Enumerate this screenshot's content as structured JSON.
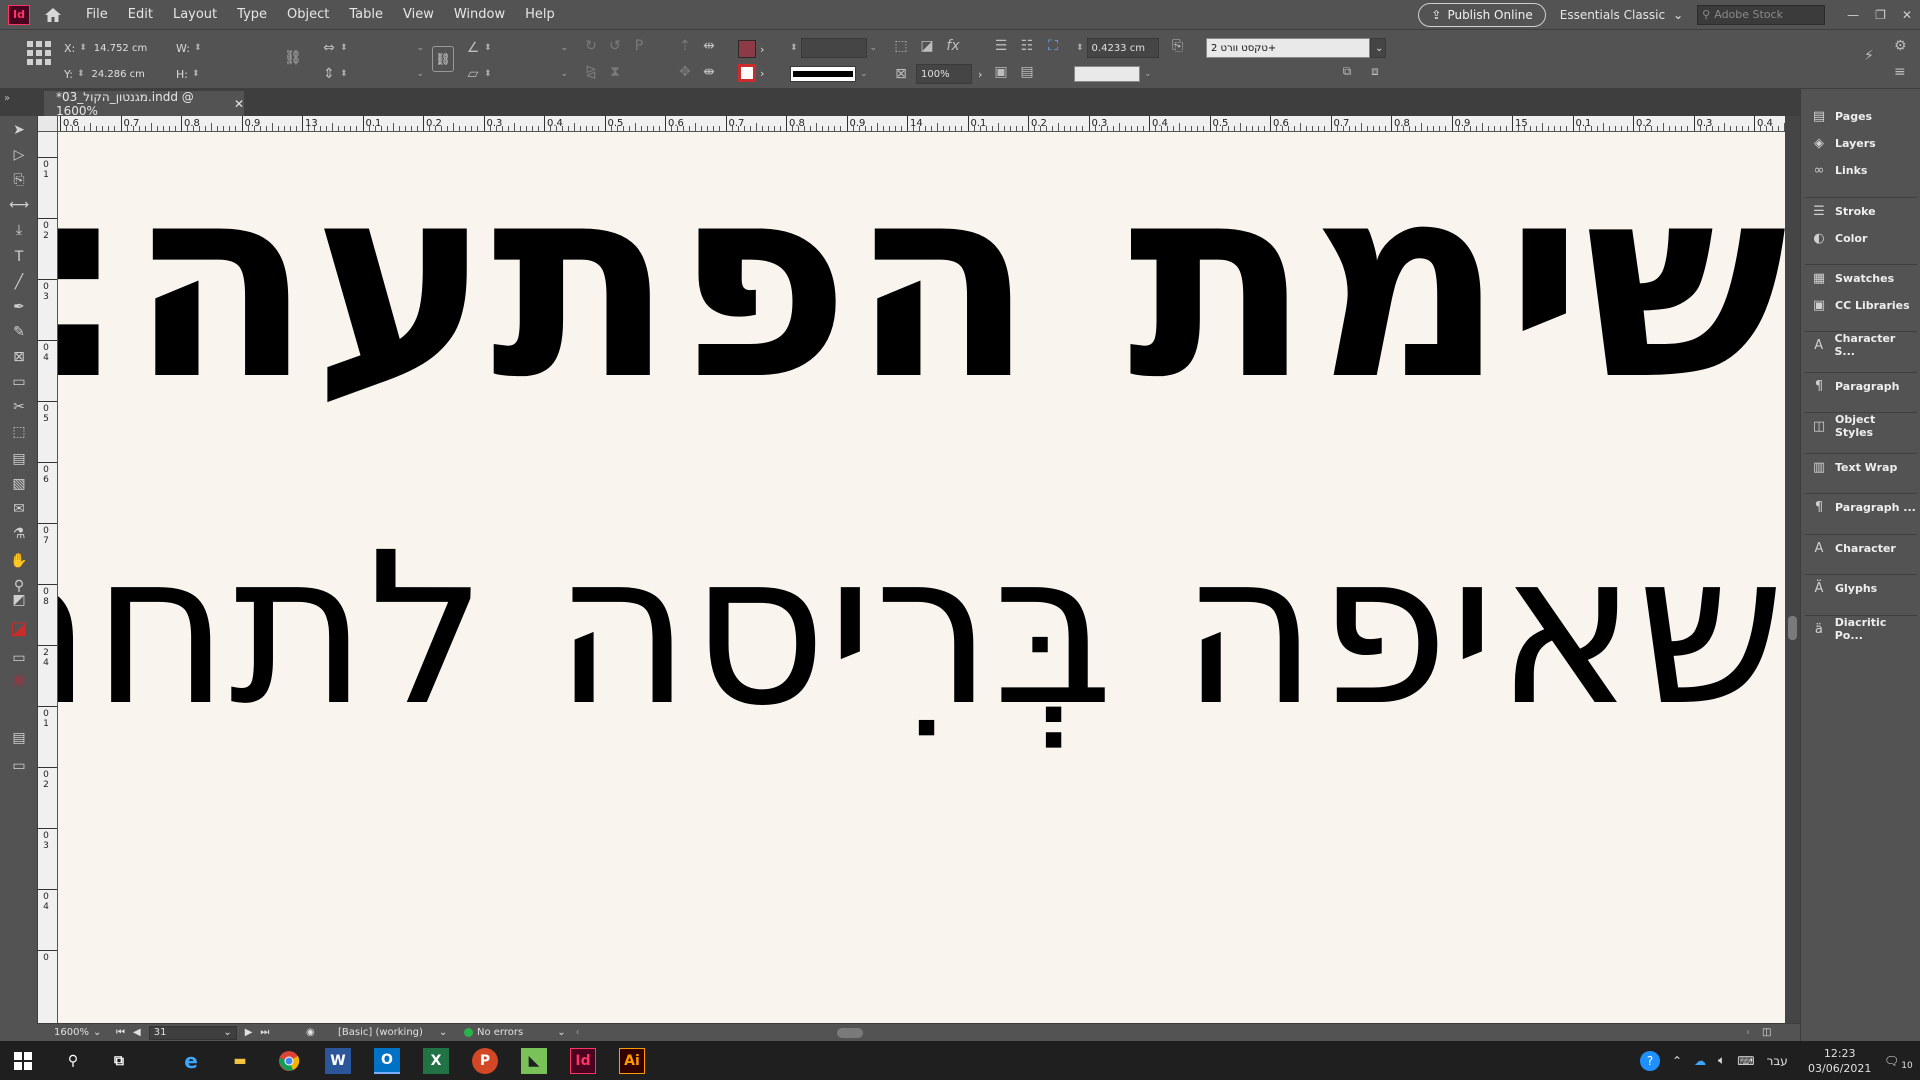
{
  "app": {
    "logo": "Id",
    "title": "Adobe InDesign"
  },
  "menu": [
    "File",
    "Edit",
    "Layout",
    "Type",
    "Object",
    "Table",
    "View",
    "Window",
    "Help"
  ],
  "topbar": {
    "publish_label": "Publish Online",
    "workspace": "Essentials Classic",
    "stock_placeholder": "Adobe Stock"
  },
  "control": {
    "x_label": "X:",
    "x_value": "14.752 cm",
    "y_label": "Y:",
    "y_value": "24.286 cm",
    "w_label": "W:",
    "h_label": "H:",
    "scale_value": "100%",
    "offset_value": "0.4233 cm",
    "style_value": "+טקסט וורט 2"
  },
  "document": {
    "tab_title": "*03_מגנטון_הקול.indd @ 1600%",
    "line1": "שימת הפתעה:",
    "line2": "שאיפה בְּרִיסה לתחתי"
  },
  "ruler_h": [
    "0.6",
    "0.7",
    "0.8",
    "0.9",
    "13",
    "0.1",
    "0.2",
    "0.3",
    "0.4",
    "0.5",
    "0.6",
    "0.7",
    "0.8",
    "0.9",
    "14",
    "0.1",
    "0.2",
    "0.3",
    "0.4",
    "0.5",
    "0.6",
    "0.7",
    "0.8",
    "0.9",
    "15",
    "0.1",
    "0.2",
    "0.3",
    "0.4"
  ],
  "ruler_v": [
    "0 1",
    "0 2",
    "0 3",
    "0 4",
    "0 5",
    "0 6",
    "0 7",
    "0 8",
    "2 4",
    "0 1",
    "0 2",
    "0 3",
    "0 4",
    "0"
  ],
  "status": {
    "zoom": "1600%",
    "page": "31",
    "preflight_profile": "[Basic] (working)",
    "errors": "No errors"
  },
  "panels": [
    {
      "label": "Pages",
      "icon": "▤"
    },
    {
      "label": "Layers",
      "icon": "◈"
    },
    {
      "label": "Links",
      "icon": "∞"
    },
    {
      "label": "Stroke",
      "icon": "☰"
    },
    {
      "label": "Color",
      "icon": "◐"
    },
    {
      "label": "Swatches",
      "icon": "▦"
    },
    {
      "label": "CC Libraries",
      "icon": "▣"
    },
    {
      "label": "Character S...",
      "icon": "A"
    },
    {
      "label": "Paragraph",
      "icon": "¶"
    },
    {
      "label": "Object Styles",
      "icon": "◫"
    },
    {
      "label": "Text Wrap",
      "icon": "▥"
    },
    {
      "label": "Paragraph ...",
      "icon": "¶"
    },
    {
      "label": "Character",
      "icon": "A"
    },
    {
      "label": "Glyphs",
      "icon": "Ä"
    },
    {
      "label": "Diacritic Po...",
      "icon": "ä"
    }
  ],
  "taskbar": {
    "language": "עבר",
    "time": "12:23",
    "date": "03/06/2021",
    "notifications": "10"
  },
  "colors": {
    "fill_swatch": "#8b3a46",
    "stroke_swatch": "#cc2b2b",
    "indesign_accent": "#ff3366",
    "illustrator_accent": "#ff9a00"
  }
}
